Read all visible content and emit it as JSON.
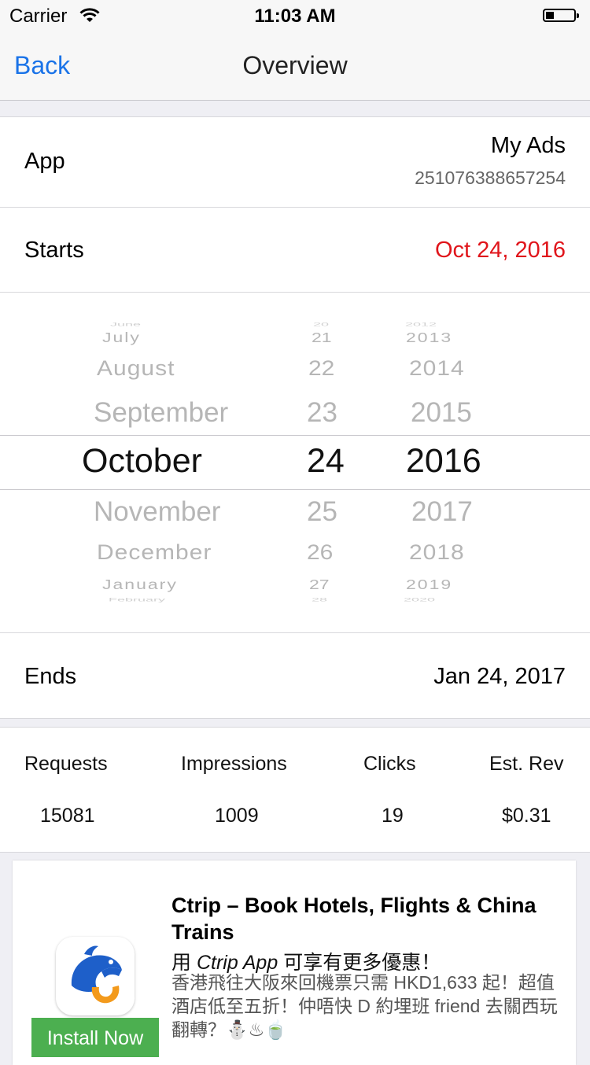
{
  "status": {
    "carrier": "Carrier",
    "time": "11:03 AM"
  },
  "nav": {
    "back_label": "Back",
    "title": "Overview"
  },
  "app_row": {
    "label": "App",
    "name": "My Ads",
    "id": "251076388657254"
  },
  "starts_row": {
    "label": "Starts",
    "value": "Oct 24, 2016",
    "value_color": "#e0151b"
  },
  "picker": {
    "months": [
      "June",
      "July",
      "August",
      "September",
      "October",
      "November",
      "December",
      "January",
      "February"
    ],
    "days": [
      "20",
      "21",
      "22",
      "23",
      "24",
      "25",
      "26",
      "27",
      "28"
    ],
    "years": [
      "2012",
      "2013",
      "2014",
      "2015",
      "2016",
      "2017",
      "2018",
      "2019",
      "2020"
    ],
    "selected": {
      "month": "October",
      "day": "24",
      "year": "2016"
    }
  },
  "ends_row": {
    "label": "Ends",
    "value": "Jan 24, 2017"
  },
  "stats": {
    "headers": [
      "Requests",
      "Impressions",
      "Clicks",
      "Est. Rev"
    ],
    "values": [
      "15081",
      "1009",
      "19",
      "$0.31"
    ]
  },
  "ad": {
    "title": "Ctrip – Book Hotels, Flights & China Trains",
    "subtitle_prefix": "用 ",
    "subtitle_app": "Ctrip App",
    "subtitle_suffix": " 可享有更多優惠！",
    "body": "香港飛往大阪來回機票只需 HKD1,633 起！超值酒店低至五折！仲唔快 D 約埋班 friend 去關西玩翻轉？⛄♨🍵",
    "install_label": "Install Now",
    "icon": "ctrip-dolphin-icon",
    "install_color": "#4caf50"
  },
  "colors": {
    "accent": "#1a73e8",
    "start_date": "#e0151b"
  }
}
